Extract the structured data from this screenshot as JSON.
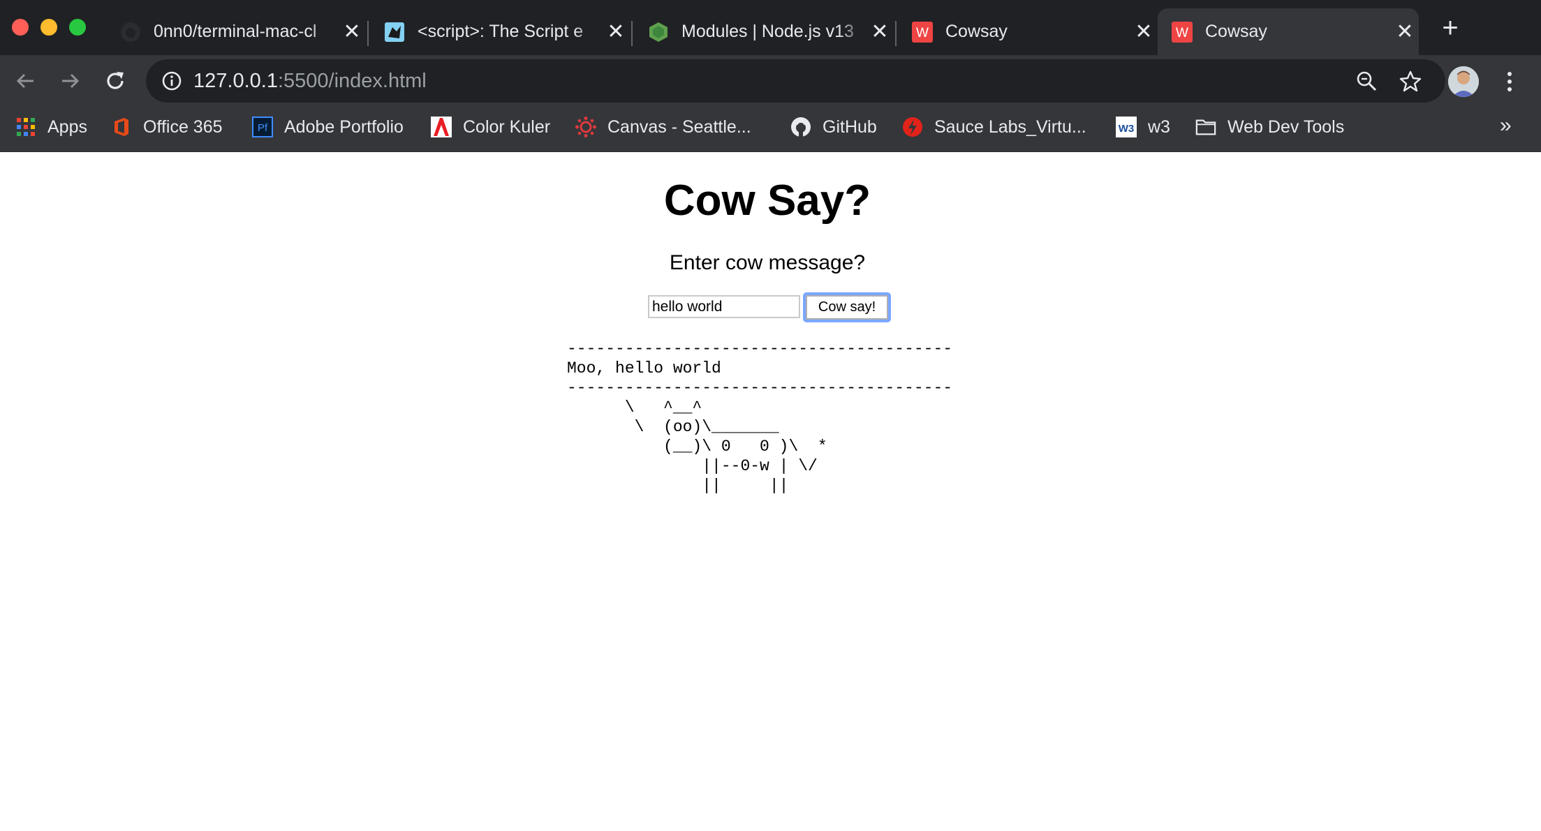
{
  "browser": {
    "tabs": [
      {
        "title": "0nn0/terminal-mac-cl",
        "icon": "github-icon",
        "active": false
      },
      {
        "title": "<script>: The Script e",
        "icon": "mdn-icon",
        "active": false
      },
      {
        "title": "Modules | Node.js v13",
        "icon": "nodejs-icon",
        "active": false
      },
      {
        "title": "Cowsay",
        "icon": "cowsay-icon",
        "active": false
      },
      {
        "title": "Cowsay",
        "icon": "cowsay-icon",
        "active": true
      }
    ],
    "close_glyph": "✕",
    "new_tab_glyph": "+",
    "url_host": "127.0.0.1",
    "url_rest": ":5500/index.html",
    "bookmarks": [
      {
        "label": "Apps",
        "icon": "apps-grid-icon"
      },
      {
        "label": "Office 365",
        "icon": "office-icon"
      },
      {
        "label": "Adobe Portfolio",
        "icon": "adobe-portfolio-icon"
      },
      {
        "label": "Color Kuler",
        "icon": "adobe-icon"
      },
      {
        "label": "Canvas - Seattle...",
        "icon": "canvas-icon"
      },
      {
        "label": "GitHub",
        "icon": "github-icon"
      },
      {
        "label": "Sauce Labs_Virtu...",
        "icon": "saucelabs-icon"
      },
      {
        "label": "w3",
        "icon": "w3-icon"
      },
      {
        "label": "Web Dev Tools",
        "icon": "folder-icon"
      }
    ],
    "bookmarks_overflow": "»"
  },
  "page": {
    "heading": "Cow Say?",
    "prompt": "Enter cow message?",
    "input_value": "hello world",
    "button_label": "Cow say!",
    "cow_output": "----------------------------------------\nMoo, hello world\n----------------------------------------\n      \\   ^__^\n       \\  (oo)\\_______\n          (__)\\ 0   0 )\\  *\n              ||--0-w | \\/\n              ||     ||"
  },
  "colors": {
    "tabstrip_bg": "#202124",
    "toolbar_bg": "#35363a",
    "cowsay_red": "#ef4444",
    "focus_ring": "#7aa7ff"
  }
}
